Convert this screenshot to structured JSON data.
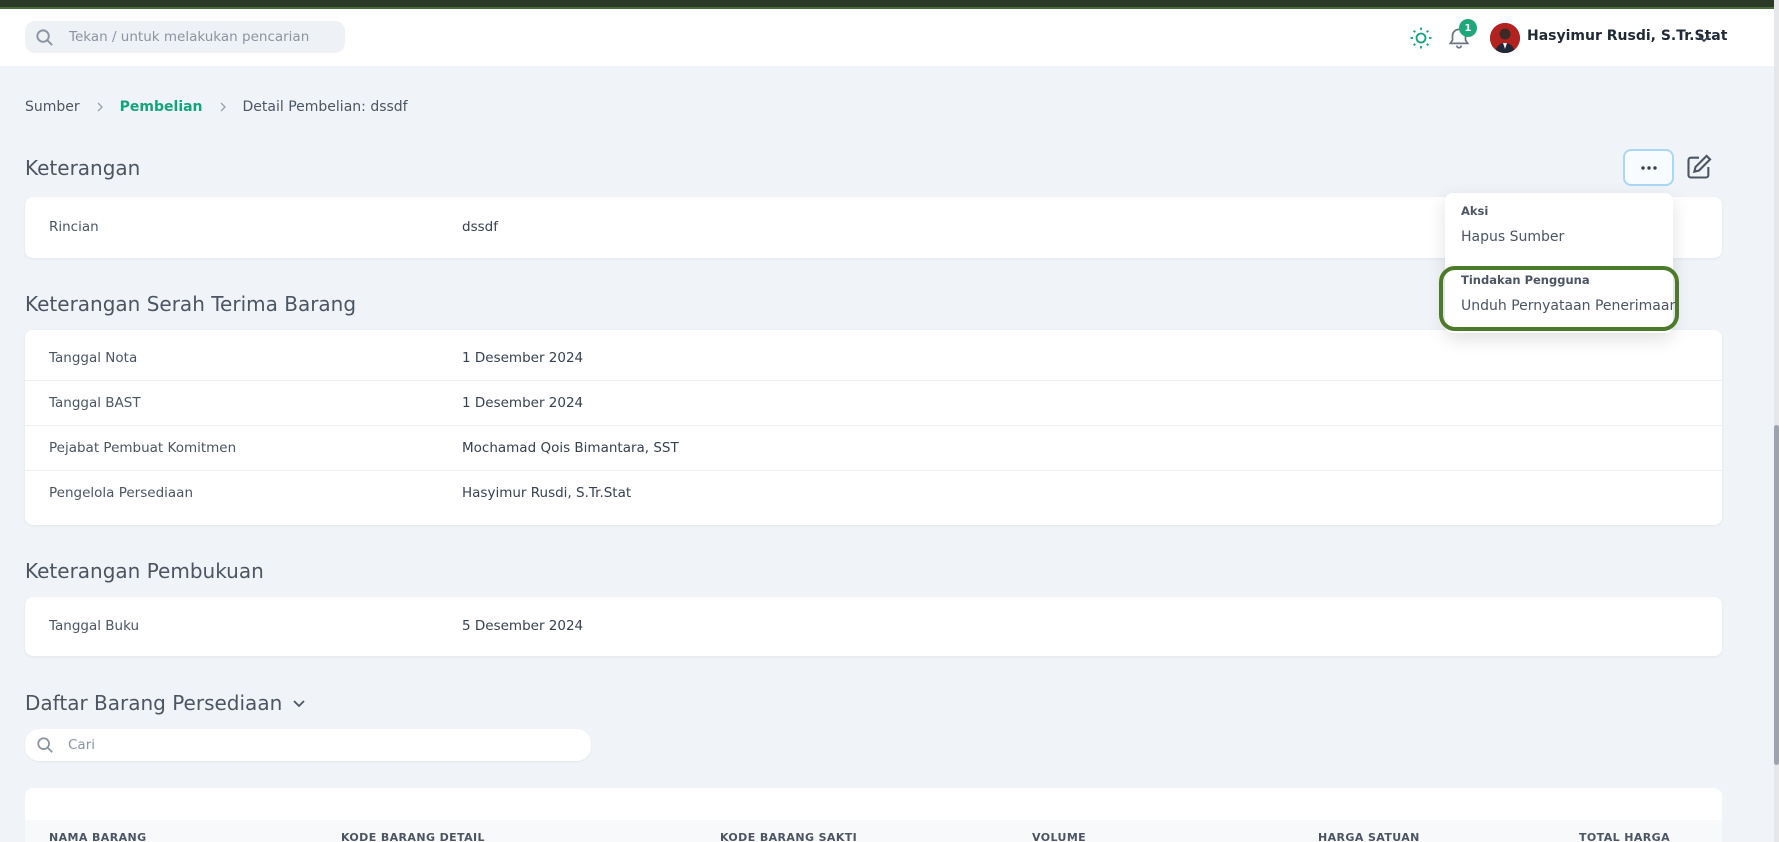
{
  "header": {
    "search_placeholder": "Tekan / untuk melakukan pencarian",
    "notification_count": "1",
    "user_name": "Hasyimur Rusdi, S.Tr.Stat"
  },
  "breadcrumb": {
    "items": [
      "Sumber",
      "Pembelian",
      "Detail Pembelian: dssdf"
    ]
  },
  "keterangan": {
    "title": "Keterangan",
    "rows": [
      {
        "label": "Rincian",
        "value": "dssdf"
      }
    ]
  },
  "serah_terima": {
    "title": "Keterangan Serah Terima Barang",
    "rows": [
      {
        "label": "Tanggal Nota",
        "value": "1 Desember 2024"
      },
      {
        "label": "Tanggal BAST",
        "value": "1 Desember 2024"
      },
      {
        "label": "Pejabat Pembuat Komitmen",
        "value": "Mochamad Qois Bimantara, SST"
      },
      {
        "label": "Pengelola Persediaan",
        "value": "Hasyimur Rusdi, S.Tr.Stat"
      }
    ]
  },
  "pembukuan": {
    "title": "Keterangan Pembukuan",
    "rows": [
      {
        "label": "Tanggal Buku",
        "value": "5 Desember 2024"
      }
    ]
  },
  "dropdown": {
    "group1_heading": "Aksi",
    "group1_item": "Hapus Sumber",
    "group2_heading": "Tindakan Pengguna",
    "group2_item": "Unduh Pernyataan Penerimaan"
  },
  "daftar_barang": {
    "title": "Daftar Barang Persediaan",
    "search_placeholder": "Cari",
    "columns": [
      "NAMA BARANG",
      "KODE BARANG DETAIL",
      "KODE BARANG SAKTI",
      "VOLUME",
      "HARGA SATUAN",
      "TOTAL HARGA"
    ]
  },
  "colors": {
    "accent": "#14a37f",
    "badge": "#1fa67a",
    "highlight_ring": "#4d7a2a",
    "background": "#f0f4f8"
  }
}
